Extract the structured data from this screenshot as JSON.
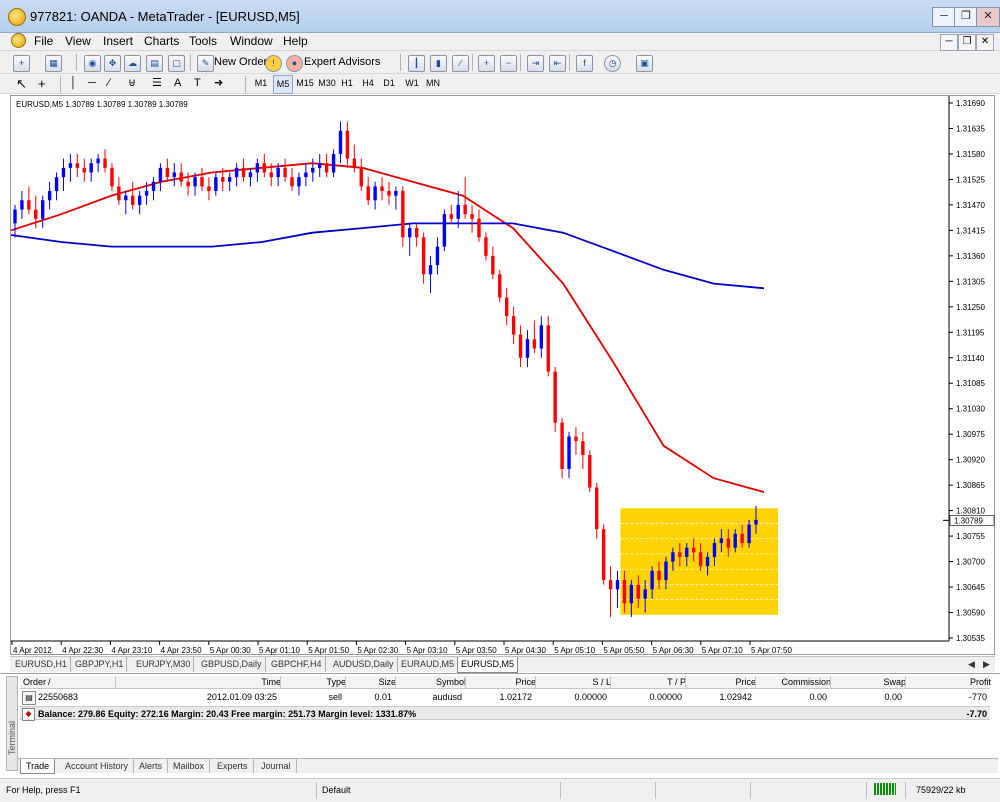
{
  "window": {
    "title": "977821: OANDA - MetaTrader - [EURUSD,M5]"
  },
  "menu": [
    "File",
    "View",
    "Insert",
    "Charts",
    "Tools",
    "Window",
    "Help"
  ],
  "toolbar": {
    "new_order": "New Order",
    "expert_advisors": "Expert Advisors"
  },
  "timeframes": [
    "M1",
    "M5",
    "M15",
    "M30",
    "H1",
    "H4",
    "D1",
    "W1",
    "MN"
  ],
  "active_timeframe": "M5",
  "chart": {
    "ohlc_label": "EURUSD,M5  1.30789 1.30789 1.30789 1.30789",
    "current_price_label": "1.30789",
    "price_ticks": [
      "1.31690",
      "1.31635",
      "1.31580",
      "1.31525",
      "1.31470",
      "1.31415",
      "1.31360",
      "1.31305",
      "1.31250",
      "1.31195",
      "1.31140",
      "1.31085",
      "1.31030",
      "1.30975",
      "1.30920",
      "1.30865",
      "1.30810",
      "1.30755",
      "1.30700",
      "1.30645",
      "1.30590",
      "1.30535"
    ],
    "time_ticks": [
      "4 Apr 2012",
      "4 Apr 22:30",
      "4 Apr 23:10",
      "4 Apr 23:50",
      "5 Apr 00:30",
      "5 Apr 01:10",
      "5 Apr 01:50",
      "5 Apr 02:30",
      "5 Apr 03:10",
      "5 Apr 03:50",
      "5 Apr 04:30",
      "5 Apr 05:10",
      "5 Apr 05:50",
      "5 Apr 06:30",
      "5 Apr 07:10",
      "5 Apr 07:50"
    ],
    "colors": {
      "bull": "#0000ff",
      "bear": "#ff0000",
      "ma_fast": "#e00000",
      "ma_slow": "#0000cc",
      "highlight": "#ffd400"
    }
  },
  "chart_data": {
    "type": "candlestick",
    "ylim": [
      1.30535,
      1.3169
    ],
    "price_ticks": [
      1.3169,
      1.31635,
      1.3158,
      1.31525,
      1.3147,
      1.31415,
      1.3136,
      1.31305,
      1.3125,
      1.31195,
      1.3114,
      1.31085,
      1.3103,
      1.30975,
      1.3092,
      1.30865,
      1.3081,
      1.30755,
      1.307,
      1.30645,
      1.3059,
      1.30535
    ],
    "time_labels": [
      "4 Apr 2012",
      "4 Apr 22:30",
      "4 Apr 23:10",
      "4 Apr 23:50",
      "5 Apr 00:30",
      "5 Apr 01:10",
      "5 Apr 01:50",
      "5 Apr 02:30",
      "5 Apr 03:10",
      "5 Apr 03:50",
      "5 Apr 04:30",
      "5 Apr 05:10",
      "5 Apr 05:50",
      "5 Apr 06:30",
      "5 Apr 07:10",
      "5 Apr 07:50"
    ],
    "current_price": 1.30789,
    "highlight_box": {
      "price_high": 1.30815,
      "price_low": 1.30585,
      "from_candle": 120,
      "to_candle": 146
    },
    "series": [
      {
        "name": "",
        "type": "line",
        "y": [
          1.31415,
          1.3145,
          1.3149,
          1.3152,
          1.3154,
          1.3155,
          1.3156,
          1.3155,
          1.3152,
          1.3149,
          1.3142,
          1.313,
          1.3113,
          1.3095,
          1.3088,
          1.3085
        ]
      },
      {
        "name": "",
        "type": "line",
        "y": [
          1.31405,
          1.3139,
          1.3138,
          1.3138,
          1.3138,
          1.3139,
          1.3141,
          1.3142,
          1.3143,
          1.3143,
          1.3143,
          1.3141,
          1.3137,
          1.3133,
          1.313,
          1.3129
        ]
      }
    ],
    "candles": [
      [
        1.3143,
        1.3147,
        1.314,
        1.3146
      ],
      [
        1.3146,
        1.315,
        1.3144,
        1.3148
      ],
      [
        1.3148,
        1.3151,
        1.3145,
        1.3146
      ],
      [
        1.3146,
        1.3149,
        1.3142,
        1.3144
      ],
      [
        1.3144,
        1.3149,
        1.3142,
        1.3148
      ],
      [
        1.3148,
        1.3152,
        1.3146,
        1.315
      ],
      [
        1.315,
        1.3154,
        1.3148,
        1.3153
      ],
      [
        1.3153,
        1.3157,
        1.315,
        1.3155
      ],
      [
        1.3155,
        1.3158,
        1.3152,
        1.3156
      ],
      [
        1.3156,
        1.3158,
        1.3153,
        1.3155
      ],
      [
        1.3155,
        1.3157,
        1.3152,
        1.3154
      ],
      [
        1.3154,
        1.3157,
        1.3152,
        1.3156
      ],
      [
        1.3156,
        1.3158,
        1.3154,
        1.3157
      ],
      [
        1.3157,
        1.3159,
        1.3154,
        1.3155
      ],
      [
        1.3155,
        1.3156,
        1.315,
        1.3151
      ],
      [
        1.3151,
        1.3153,
        1.3147,
        1.3148
      ],
      [
        1.3148,
        1.315,
        1.3145,
        1.3149
      ],
      [
        1.3149,
        1.3152,
        1.3146,
        1.3147
      ],
      [
        1.3147,
        1.315,
        1.3145,
        1.3149
      ],
      [
        1.3149,
        1.3152,
        1.3147,
        1.315
      ],
      [
        1.315,
        1.3153,
        1.3148,
        1.3152
      ],
      [
        1.3152,
        1.3156,
        1.315,
        1.3155
      ],
      [
        1.3155,
        1.3157,
        1.3152,
        1.3153
      ],
      [
        1.3153,
        1.3156,
        1.3151,
        1.3154
      ],
      [
        1.3154,
        1.3156,
        1.3151,
        1.3152
      ],
      [
        1.3152,
        1.3154,
        1.3149,
        1.3151
      ],
      [
        1.3151,
        1.3154,
        1.3149,
        1.3153
      ],
      [
        1.3153,
        1.3155,
        1.315,
        1.3151
      ],
      [
        1.3151,
        1.3153,
        1.3148,
        1.315
      ],
      [
        1.315,
        1.3154,
        1.3149,
        1.3153
      ],
      [
        1.3153,
        1.3155,
        1.315,
        1.3152
      ],
      [
        1.3152,
        1.3154,
        1.315,
        1.3153
      ],
      [
        1.3153,
        1.3156,
        1.3151,
        1.3155
      ],
      [
        1.3155,
        1.3157,
        1.3152,
        1.3153
      ],
      [
        1.3153,
        1.3155,
        1.3151,
        1.3154
      ],
      [
        1.3154,
        1.3157,
        1.3152,
        1.3156
      ],
      [
        1.3156,
        1.3158,
        1.3153,
        1.3154
      ],
      [
        1.3154,
        1.3156,
        1.3151,
        1.3153
      ],
      [
        1.3153,
        1.3156,
        1.3151,
        1.3155
      ],
      [
        1.3155,
        1.3157,
        1.3152,
        1.3153
      ],
      [
        1.3153,
        1.3155,
        1.315,
        1.3151
      ],
      [
        1.3151,
        1.3154,
        1.3149,
        1.3153
      ],
      [
        1.3153,
        1.3156,
        1.3151,
        1.3154
      ],
      [
        1.3154,
        1.3157,
        1.3152,
        1.3155
      ],
      [
        1.3155,
        1.3158,
        1.3153,
        1.3156
      ],
      [
        1.3156,
        1.3158,
        1.3153,
        1.3154
      ],
      [
        1.3154,
        1.3159,
        1.3153,
        1.3158
      ],
      [
        1.3158,
        1.3165,
        1.3156,
        1.3163
      ],
      [
        1.3163,
        1.3165,
        1.3155,
        1.3157
      ],
      [
        1.3157,
        1.316,
        1.3154,
        1.3155
      ],
      [
        1.3155,
        1.3157,
        1.315,
        1.3151
      ],
      [
        1.3151,
        1.3153,
        1.3147,
        1.3148
      ],
      [
        1.3148,
        1.3152,
        1.3146,
        1.3151
      ],
      [
        1.3151,
        1.3153,
        1.3148,
        1.315
      ],
      [
        1.315,
        1.3152,
        1.3147,
        1.3149
      ],
      [
        1.3149,
        1.3151,
        1.3146,
        1.315
      ],
      [
        1.315,
        1.3151,
        1.3138,
        1.314
      ],
      [
        1.314,
        1.3143,
        1.3136,
        1.3142
      ],
      [
        1.3142,
        1.3143,
        1.3138,
        1.314
      ],
      [
        1.314,
        1.3141,
        1.313,
        1.3132
      ],
      [
        1.3132,
        1.3136,
        1.3128,
        1.3134
      ],
      [
        1.3134,
        1.314,
        1.3132,
        1.3138
      ],
      [
        1.3138,
        1.3146,
        1.3137,
        1.3145
      ],
      [
        1.3145,
        1.3147,
        1.3143,
        1.3144
      ],
      [
        1.3144,
        1.315,
        1.3142,
        1.3147
      ],
      [
        1.3147,
        1.3153,
        1.3144,
        1.3145
      ],
      [
        1.3145,
        1.3147,
        1.3141,
        1.3144
      ],
      [
        1.3144,
        1.3146,
        1.3139,
        1.314
      ],
      [
        1.314,
        1.3141,
        1.3135,
        1.3136
      ],
      [
        1.3136,
        1.3138,
        1.3131,
        1.3132
      ],
      [
        1.3132,
        1.3133,
        1.3126,
        1.3127
      ],
      [
        1.3127,
        1.3129,
        1.3121,
        1.3123
      ],
      [
        1.3123,
        1.3125,
        1.3117,
        1.3119
      ],
      [
        1.3119,
        1.3121,
        1.3112,
        1.3114
      ],
      [
        1.3114,
        1.312,
        1.3112,
        1.3118
      ],
      [
        1.3118,
        1.3122,
        1.3115,
        1.3116
      ],
      [
        1.3116,
        1.3123,
        1.3114,
        1.3121
      ],
      [
        1.3121,
        1.3123,
        1.311,
        1.3111
      ],
      [
        1.3111,
        1.3112,
        1.3098,
        1.31
      ],
      [
        1.31,
        1.3101,
        1.3088,
        1.309
      ],
      [
        1.309,
        1.3098,
        1.3088,
        1.3097
      ],
      [
        1.3097,
        1.3099,
        1.3093,
        1.3096
      ],
      [
        1.3096,
        1.3098,
        1.309,
        1.3093
      ],
      [
        1.3093,
        1.3094,
        1.3085,
        1.3086
      ],
      [
        1.3086,
        1.3087,
        1.3075,
        1.3077
      ],
      [
        1.3077,
        1.3078,
        1.3065,
        1.3066
      ],
      [
        1.3066,
        1.3069,
        1.3058,
        1.3064
      ],
      [
        1.3064,
        1.3068,
        1.306,
        1.3066
      ],
      [
        1.3066,
        1.3068,
        1.3059,
        1.3061
      ],
      [
        1.3061,
        1.3066,
        1.3058,
        1.3065
      ],
      [
        1.3065,
        1.3067,
        1.306,
        1.3062
      ],
      [
        1.3062,
        1.3066,
        1.3059,
        1.3064
      ],
      [
        1.3064,
        1.3069,
        1.3062,
        1.3068
      ],
      [
        1.3068,
        1.307,
        1.3064,
        1.3066
      ],
      [
        1.3066,
        1.3071,
        1.3064,
        1.307
      ],
      [
        1.307,
        1.3073,
        1.3068,
        1.3072
      ],
      [
        1.3072,
        1.3074,
        1.3069,
        1.3071
      ],
      [
        1.3071,
        1.3074,
        1.3069,
        1.3073
      ],
      [
        1.3073,
        1.3075,
        1.307,
        1.3072
      ],
      [
        1.3072,
        1.3074,
        1.3068,
        1.3069
      ],
      [
        1.3069,
        1.3072,
        1.3067,
        1.3071
      ],
      [
        1.3071,
        1.3075,
        1.3069,
        1.3074
      ],
      [
        1.3074,
        1.3077,
        1.3072,
        1.3075
      ],
      [
        1.3075,
        1.3077,
        1.3071,
        1.3073
      ],
      [
        1.3073,
        1.3077,
        1.3072,
        1.3076
      ],
      [
        1.3076,
        1.3078,
        1.3073,
        1.3074
      ],
      [
        1.3074,
        1.3079,
        1.3073,
        1.3078
      ],
      [
        1.3078,
        1.3082,
        1.3076,
        1.3079
      ]
    ]
  },
  "chart_tabs": [
    "EURUSD,H1",
    "GBPJPY,H1",
    "EURJPY,M30",
    "GBPUSD,Daily",
    "GBPCHF,H4",
    "AUDUSD,Daily",
    "EURAUD,M5",
    "EURUSD,M5"
  ],
  "active_chart_tab": "EURUSD,M5",
  "terminal": {
    "side_label": "Terminal",
    "columns": [
      "Order",
      "/",
      "Time",
      "Type",
      "Size",
      "Symbol",
      "Price",
      "S / L",
      "T / P",
      "Price",
      "Commission",
      "Swap",
      "Profit"
    ],
    "row": {
      "order": "22550683",
      "time": "2012.01.09 03:25",
      "type": "sell",
      "size": "0.01",
      "symbol": "audusd",
      "price": "1.02172",
      "sl": "0.00000",
      "tp": "0.00000",
      "price2": "1.02942",
      "commission": "0.00",
      "swap": "0.00",
      "profit": "-770"
    },
    "balance_line": "Balance: 279.86  Equity: 272.16  Margin: 20.43  Free margin: 251.73  Margin level: 1331.87%",
    "balance_profit": "-7.70",
    "tabs": [
      "Trade",
      "Account History",
      "Alerts",
      "Mailbox",
      "Experts",
      "Journal"
    ],
    "active_tab": "Trade"
  },
  "status": {
    "help": "For Help, press F1",
    "profile": "Default",
    "traffic": "75929/22 kb"
  }
}
